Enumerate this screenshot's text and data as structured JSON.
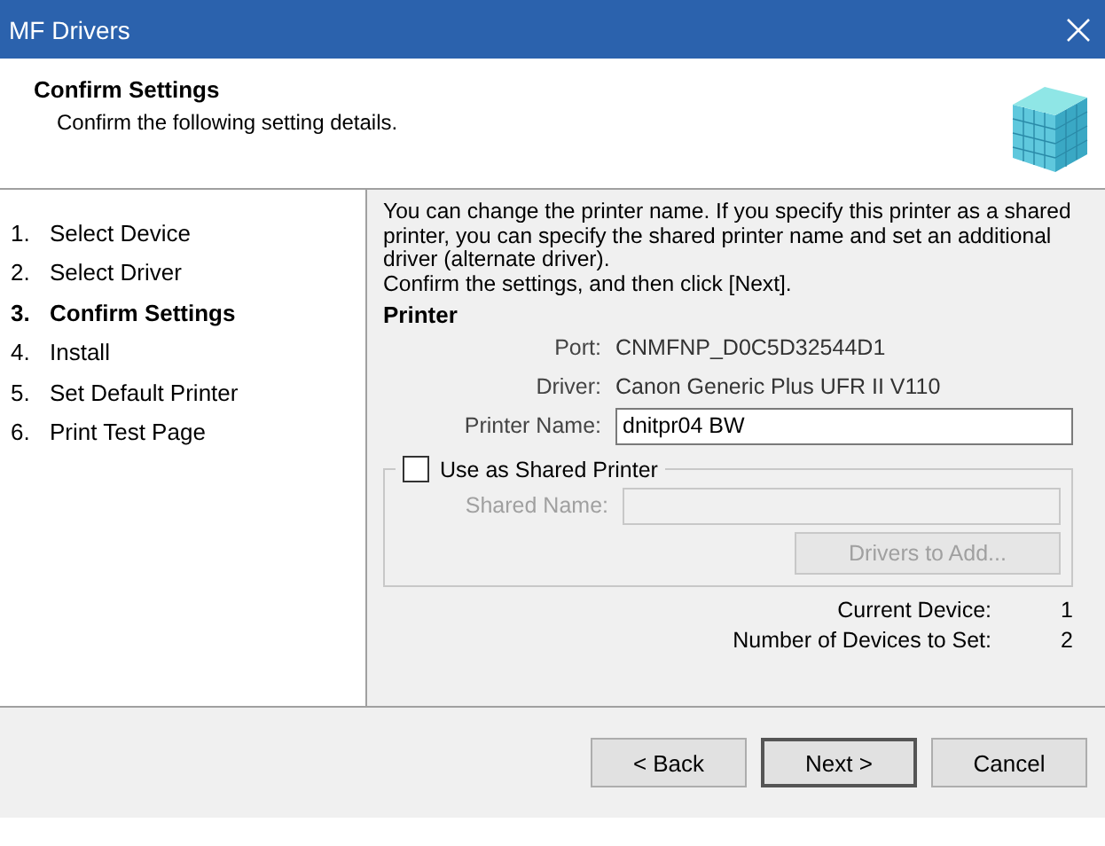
{
  "window": {
    "title": "MF Drivers"
  },
  "header": {
    "title": "Confirm Settings",
    "subtitle": "Confirm the following setting details."
  },
  "steps": [
    {
      "number": "1.",
      "label": "Select Device",
      "selected": false
    },
    {
      "number": "2.",
      "label": "Select Driver",
      "selected": false
    },
    {
      "number": "3.",
      "label": "Confirm Settings",
      "selected": true
    },
    {
      "number": "4.",
      "label": "Install",
      "selected": false
    },
    {
      "number": "5.",
      "label": "Set Default Printer",
      "selected": false
    },
    {
      "number": "6.",
      "label": "Print Test Page",
      "selected": false
    }
  ],
  "intro": [
    "You can change the printer name. If you specify this printer as a shared printer, you can specify the shared printer name and set an additional driver (alternate driver).",
    "Confirm the settings, and then click [Next]."
  ],
  "printer": {
    "heading": "Printer",
    "port_label": "Port:",
    "port": "CNMFNP_D0C5D32544D1",
    "driver_label": "Driver:",
    "driver": "Canon Generic Plus UFR II V110",
    "name_label": "Printer Name:",
    "name": "dnitpr04 BW"
  },
  "shared": {
    "label": "Use as Shared Printer",
    "checked": false,
    "name_label": "Shared Name:",
    "disabled": true,
    "drivers_button": "Drivers to Add..."
  },
  "counts": [
    {
      "label": "Current Device:",
      "value": "1"
    },
    {
      "label": "Number of Devices to Set:",
      "value": "2"
    }
  ],
  "buttons": [
    {
      "label": "< Back",
      "selected": false
    },
    {
      "label": "Next >",
      "selected": true
    },
    {
      "label": "Cancel",
      "selected": false
    }
  ]
}
